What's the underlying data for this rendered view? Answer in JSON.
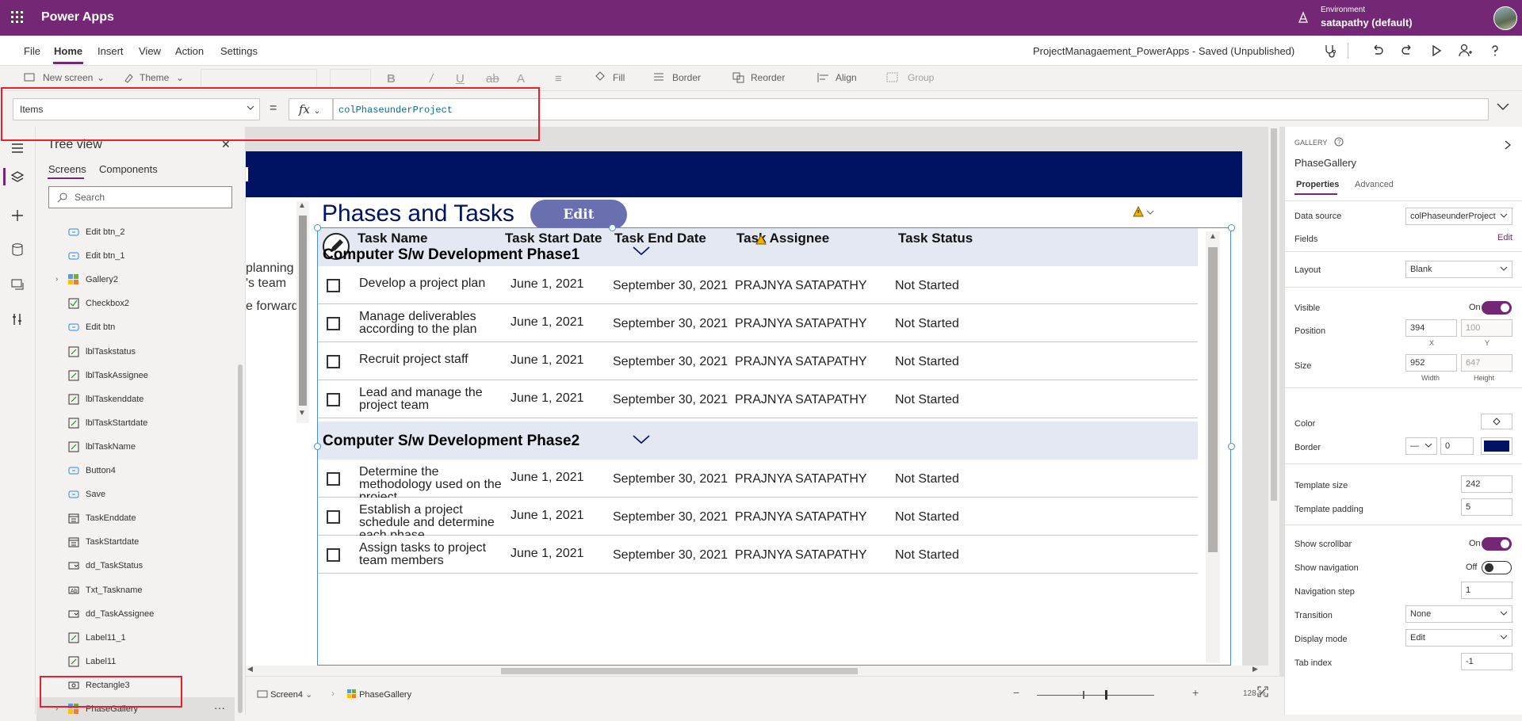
{
  "topbar": {
    "app_title": "Power Apps",
    "env_label": "Environment",
    "env_value": "satapathy (default)"
  },
  "menubar": {
    "items": [
      "File",
      "Home",
      "Insert",
      "View",
      "Action",
      "Settings"
    ],
    "doc_title": "ProjectManagaement_PowerApps - Saved (Unpublished)"
  },
  "ribbon": {
    "new_screen": "New screen",
    "theme": "Theme",
    "fill": "Fill",
    "border": "Border",
    "reorder": "Reorder",
    "align": "Align",
    "group": "Group"
  },
  "formula": {
    "property": "Items",
    "equals": "=",
    "fx": "fx",
    "value": "colPhaseunderProject"
  },
  "treeview": {
    "title": "Tree view",
    "tabs": [
      "Screens",
      "Components"
    ],
    "search_placeholder": "Search",
    "items": [
      {
        "label": "Edit btn_2",
        "icon": "button-icon"
      },
      {
        "label": "Edit btn_1",
        "icon": "button-icon"
      },
      {
        "label": "Gallery2",
        "icon": "gallery-icon",
        "expandable": true
      },
      {
        "label": "Checkbox2",
        "icon": "checkbox-icon"
      },
      {
        "label": "Edit btn",
        "icon": "button-icon"
      },
      {
        "label": "lblTaskstatus",
        "icon": "label-icon"
      },
      {
        "label": "lblTaskAssignee",
        "icon": "label-icon"
      },
      {
        "label": "lblTaskenddate",
        "icon": "label-icon"
      },
      {
        "label": "lblTaskStartdate",
        "icon": "label-icon"
      },
      {
        "label": "lblTaskName",
        "icon": "label-icon"
      },
      {
        "label": "Button4",
        "icon": "button-icon"
      },
      {
        "label": "Save",
        "icon": "button-icon"
      },
      {
        "label": "TaskEnddate",
        "icon": "datepicker-icon"
      },
      {
        "label": "TaskStartdate",
        "icon": "datepicker-icon"
      },
      {
        "label": "dd_TaskStatus",
        "icon": "dropdown-icon"
      },
      {
        "label": "Txt_Taskname",
        "icon": "textinput-icon"
      },
      {
        "label": "dd_TaskAssignee",
        "icon": "dropdown-icon"
      },
      {
        "label": "Label11_1",
        "icon": "label-icon"
      },
      {
        "label": "Label11",
        "icon": "label-icon"
      },
      {
        "label": "Rectangle3",
        "icon": "shape-icon"
      },
      {
        "label": "PhaseGallery",
        "icon": "gallery-icon",
        "expandable": true,
        "selected": true,
        "more": "···"
      }
    ]
  },
  "canvas": {
    "header_text": "N",
    "bg_text_lines": [
      "planning",
      "'s team",
      "",
      "e forward"
    ],
    "heading": "Phases and Tasks",
    "edit_button": "Edit",
    "columns": [
      "Task Name",
      "Task Start Date",
      "Task End Date",
      "Task Assignee",
      "Task Status"
    ],
    "phases": [
      {
        "name": "Computer S/w Development Phase1",
        "tasks": [
          {
            "name": "Develop a project plan",
            "start": "June 1, 2021",
            "end": "September 30, 2021",
            "assignee": "PRAJNYA SATAPATHY",
            "status": "Not Started"
          },
          {
            "name": "Manage deliverables according to the plan",
            "start": "June 1, 2021",
            "end": "September 30, 2021",
            "assignee": "PRAJNYA SATAPATHY",
            "status": "Not Started"
          },
          {
            "name": "Recruit project staff",
            "start": "June 1, 2021",
            "end": "September 30, 2021",
            "assignee": "PRAJNYA SATAPATHY",
            "status": "Not Started"
          },
          {
            "name": "Lead and manage the project team",
            "start": "June 1, 2021",
            "end": "September 30, 2021",
            "assignee": "PRAJNYA SATAPATHY",
            "status": "Not Started"
          }
        ]
      },
      {
        "name": "Computer S/w Development Phase2",
        "tasks": [
          {
            "name": "Determine the methodology used on the project",
            "start": "June 1, 2021",
            "end": "September 30, 2021",
            "assignee": "PRAJNYA SATAPATHY",
            "status": "Not Started"
          },
          {
            "name": "Establish a project schedule and determine each phase",
            "start": "June 1, 2021",
            "end": "September 30, 2021",
            "assignee": "PRAJNYA SATAPATHY",
            "status": "Not Started"
          },
          {
            "name": "Assign tasks to project team members",
            "start": "June 1, 2021",
            "end": "September 30, 2021",
            "assignee": "PRAJNYA SATAPATHY",
            "status": "Not Started"
          }
        ]
      }
    ]
  },
  "statusbar": {
    "screen": "Screen4",
    "gallery": "PhaseGallery",
    "zoom": "128 %",
    "minus": "−",
    "plus": "+"
  },
  "properties": {
    "type": "GALLERY",
    "name": "PhaseGallery",
    "tabs": [
      "Properties",
      "Advanced"
    ],
    "data_source_label": "Data source",
    "data_source": "colPhaseunderProject",
    "fields_label": "Fields",
    "fields_edit": "Edit",
    "layout_label": "Layout",
    "layout": "Blank",
    "visible_label": "Visible",
    "visible_state": "On",
    "position_label": "Position",
    "x": "394",
    "y": "100",
    "x_label": "X",
    "y_label": "Y",
    "size_label": "Size",
    "width": "952",
    "height": "647",
    "width_label": "Width",
    "height_label": "Height",
    "color_label": "Color",
    "border_label": "Border",
    "border_style": "—",
    "border_width": "0",
    "border_color": "#001262",
    "template_size_label": "Template size",
    "template_size": "242",
    "template_padding_label": "Template padding",
    "template_padding": "5",
    "show_scrollbar_label": "Show scrollbar",
    "show_scrollbar_state": "On",
    "show_navigation_label": "Show navigation",
    "show_navigation_state": "Off",
    "navigation_step_label": "Navigation step",
    "navigation_step": "1",
    "transition_label": "Transition",
    "transition": "None",
    "display_mode_label": "Display mode",
    "display_mode": "Edit",
    "tab_index_label": "Tab index",
    "tab_index": "-1"
  },
  "colors": {
    "brand": "#742774",
    "app_header": "#001262",
    "highlight": "#e8202a",
    "edit_button": "#6a6fb0"
  }
}
